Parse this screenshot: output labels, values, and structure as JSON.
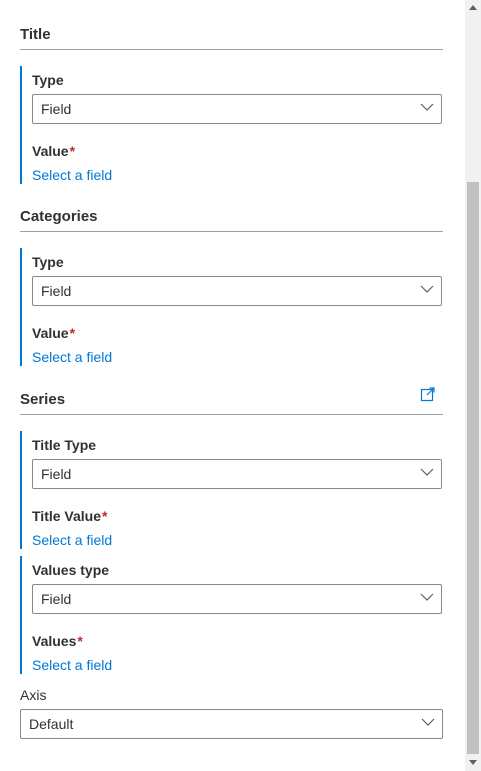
{
  "sections": {
    "title": {
      "heading": "Title",
      "type_label": "Type",
      "type_value": "Field",
      "value_label": "Value",
      "required_mark": "*",
      "value_link": "Select a field"
    },
    "categories": {
      "heading": "Categories",
      "type_label": "Type",
      "type_value": "Field",
      "value_label": "Value",
      "required_mark": "*",
      "value_link": "Select a field"
    },
    "series": {
      "heading": "Series",
      "expand_icon": "expand-icon",
      "title_type_label": "Title Type",
      "title_type_value": "Field",
      "title_value_label": "Title Value",
      "required_mark": "*",
      "title_value_link": "Select a field",
      "values_type_label": "Values type",
      "values_type_value": "Field",
      "values_label": "Values",
      "values_link": "Select a field"
    },
    "axis": {
      "label": "Axis",
      "value": "Default"
    }
  },
  "colors": {
    "accent": "#0078d4",
    "required": "#c4262e",
    "text": "#323130"
  }
}
